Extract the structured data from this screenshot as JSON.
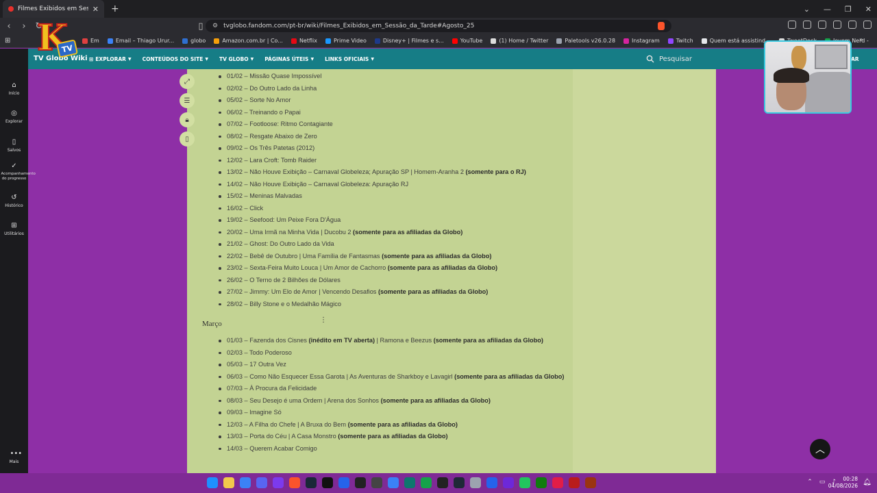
{
  "browser": {
    "tab_title": "Filmes Exibidos em Sessão da Ta",
    "url": "tvglobo.fandom.com/pt-br/wiki/Filmes_Exibidos_em_Sessão_da_Tarde#Agosto_25",
    "bookmarks": [
      {
        "label": "Em",
        "color": "#e04040"
      },
      {
        "label": "Email – Thiago Urur...",
        "color": "#3b82f6"
      },
      {
        "label": "globo",
        "color": "#2f6fd1"
      },
      {
        "label": "Amazon.com.br | Co...",
        "color": "#f59e0b"
      },
      {
        "label": "Netflix",
        "color": "#e50914"
      },
      {
        "label": "Prime Video",
        "color": "#1a98ff"
      },
      {
        "label": "Disney+ | Filmes e s...",
        "color": "#1e3a8a"
      },
      {
        "label": "YouTube",
        "color": "#ff0000"
      },
      {
        "label": "(1) Home / Twitter",
        "color": "#dddddd"
      },
      {
        "label": "Paletools v26.0.28",
        "color": "#9ca3af"
      },
      {
        "label": "Instagram",
        "color": "#d6249f"
      },
      {
        "label": "Twitch",
        "color": "#9146ff"
      },
      {
        "label": "Quem está assistind...",
        "color": "#e5e7eb"
      },
      {
        "label": "TweetDeck",
        "color": "#dddddd"
      },
      {
        "label": "Jovem Nerd -",
        "color": "#16a34a"
      }
    ]
  },
  "wiki": {
    "title": "TV Globo Wiki",
    "menu": [
      "EXPLORAR",
      "CONTEÚDOS DO SITE",
      "TV GLOBO",
      "PÁGINAS ÚTEIS",
      "LINKS OFICIAIS"
    ],
    "search_placeholder": "Pesquisar",
    "enter_fragment": "AR"
  },
  "sidebar": {
    "items": [
      {
        "label": "Início",
        "icon": "⌂"
      },
      {
        "label": "Explorar",
        "icon": "◎"
      },
      {
        "label": "Salvos",
        "icon": "▯"
      },
      {
        "label": "Acompanhamento do progresso",
        "icon": "✓"
      },
      {
        "label": "Histórico",
        "icon": "↺"
      },
      {
        "label": "Utilitários",
        "icon": "⊞"
      },
      {
        "label": "Mais",
        "icon": "•••"
      }
    ]
  },
  "content": {
    "february": [
      {
        "text": "01/02 – Missão Quase Impossível",
        "bold": ""
      },
      {
        "text": "02/02 – Do Outro Lado da Linha",
        "bold": ""
      },
      {
        "text": "05/02 – Sorte No Amor",
        "bold": ""
      },
      {
        "text": "06/02 – Treinando o Papai",
        "bold": ""
      },
      {
        "text": "07/02 – Footloose: Ritmo Contagiante",
        "bold": ""
      },
      {
        "text": "08/02 – Resgate Abaixo de Zero",
        "bold": ""
      },
      {
        "text": "09/02 – Os Três Patetas (2012)",
        "bold": ""
      },
      {
        "text": "12/02 – Lara Croft: Tomb Raider",
        "bold": ""
      },
      {
        "text": "13/02 – Não Houve Exibição – Carnaval Globeleza; Apuração SP | Homem-Aranha 2 ",
        "bold": "(somente para o RJ)"
      },
      {
        "text": "14/02 – Não Houve Exibição – Carnaval Globeleza: Apuração RJ",
        "bold": ""
      },
      {
        "text": "15/02 – Meninas Malvadas",
        "bold": ""
      },
      {
        "text": "16/02 – Click",
        "bold": ""
      },
      {
        "text": "19/02 – Seefood: Um Peixe Fora D'Água",
        "bold": ""
      },
      {
        "text": "20/02 – Uma Irmã na Minha Vida | Ducobu 2 ",
        "bold": "(somente para as afiliadas da Globo)"
      },
      {
        "text": "21/02 – Ghost: Do Outro Lado da Vida",
        "bold": ""
      },
      {
        "text": "22/02 – Bebê de Outubro | Uma Família de Fantasmas ",
        "bold": "(somente para as afiliadas da Globo)"
      },
      {
        "text": "23/02 – Sexta-Feira Muito Louca | Um Amor de Cachorro ",
        "bold": "(somente para as afiliadas da Globo)"
      },
      {
        "text": "26/02 – O Terno de 2 Bilhões de Dólares",
        "bold": ""
      },
      {
        "text": "27/02 – Jimmy: Um Elo de Amor | Vencendo Desafios ",
        "bold": "(somente para as afiliadas da Globo)"
      },
      {
        "text": "28/02 – Billy Stone e o Medalhão Mágico",
        "bold": ""
      }
    ],
    "march_heading": "Março",
    "march": [
      {
        "parts": [
          "01/03 – Fazenda dos Cisnes ",
          "(inédito em TV aberta)",
          " | Ramona e Beezus ",
          "(somente para as afiliadas da Globo)"
        ]
      },
      {
        "parts": [
          "02/03 – Todo Poderoso"
        ]
      },
      {
        "parts": [
          "05/03 – 17 Outra Vez"
        ]
      },
      {
        "parts": [
          "06/03 – Como Não Esquecer Essa Garota | As Aventuras de Sharkboy e Lavagirl ",
          "(somente para as afiliadas da Globo)"
        ]
      },
      {
        "parts": [
          "07/03 – À Procura da Felicidade"
        ]
      },
      {
        "parts": [
          "08/03 – Seu Desejo é uma Ordem | Arena dos Sonhos ",
          "(somente para as afiliadas da Globo)"
        ]
      },
      {
        "parts": [
          "09/03 – Imagine Só"
        ]
      },
      {
        "parts": [
          "12/03 – A Filha do Chefe | A Bruxa do Bem ",
          "(somente para as afiliadas da Globo)"
        ]
      },
      {
        "parts": [
          "13/03 – Porta do Céu | A Casa Monstro ",
          "(somente para as afiliadas da Globo)"
        ]
      },
      {
        "parts": [
          "14/03 – Querem Acabar Comigo"
        ]
      }
    ]
  },
  "logo": {
    "letter": "K",
    "badge": "TV"
  },
  "taskbar": {
    "apps": [
      "#1e90ff",
      "#f2c94c",
      "#3b82f6",
      "#5865f2",
      "#7c3aed",
      "#fb542b",
      "#1b2838",
      "#111111",
      "#2563eb",
      "#222222",
      "#444444",
      "#3b82f6",
      "#0f766e",
      "#16a34a",
      "#222222",
      "#1f2937",
      "#9ca3af",
      "#2563eb",
      "#6d28d9",
      "#22c55e",
      "#107c10",
      "#e11d48",
      "#b91c1c",
      "#9a3412"
    ],
    "time": "00:28",
    "date": "04/08/2026"
  }
}
